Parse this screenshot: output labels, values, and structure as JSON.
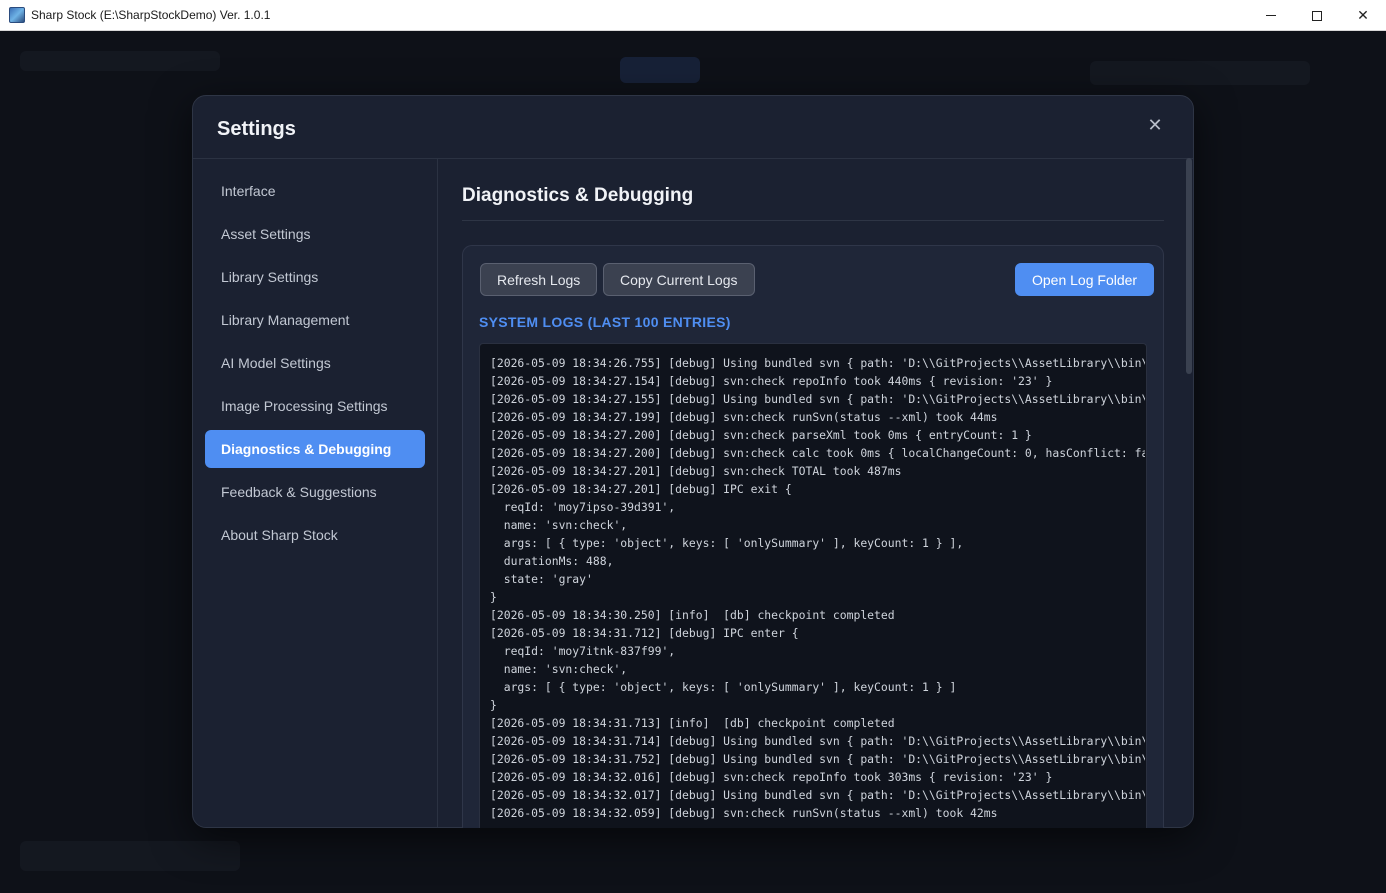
{
  "window": {
    "title": "Sharp Stock (E:\\SharpStockDemo) Ver. 1.0.1",
    "minimize_glyph": "",
    "maximize_glyph": "",
    "close_glyph": "✕"
  },
  "modal": {
    "title": "Settings",
    "close_glyph": "✕"
  },
  "sidebar": {
    "items": [
      {
        "label": "Interface"
      },
      {
        "label": "Asset Settings"
      },
      {
        "label": "Library Settings"
      },
      {
        "label": "Library Management"
      },
      {
        "label": "AI Model Settings"
      },
      {
        "label": "Image Processing Settings"
      },
      {
        "label": "Diagnostics & Debugging",
        "active": true
      },
      {
        "label": "Feedback & Suggestions"
      },
      {
        "label": "About Sharp Stock"
      }
    ]
  },
  "content": {
    "section_title": "Diagnostics & Debugging",
    "buttons": {
      "refresh": "Refresh Logs",
      "copy": "Copy Current Logs",
      "open_folder": "Open Log Folder"
    },
    "logs_label": "SYSTEM LOGS (LAST 100 ENTRIES)",
    "log_lines": [
      "[2026-05-09 18:34:26.755] [debug] Using bundled svn { path: 'D:\\\\GitProjects\\\\AssetLibrary\\\\bin\\\\win",
      "[2026-05-09 18:34:27.154] [debug] svn:check repoInfo took 440ms { revision: '23' }",
      "[2026-05-09 18:34:27.155] [debug] Using bundled svn { path: 'D:\\\\GitProjects\\\\AssetLibrary\\\\bin\\\\win",
      "[2026-05-09 18:34:27.199] [debug] svn:check runSvn(status --xml) took 44ms",
      "[2026-05-09 18:34:27.200] [debug] svn:check parseXml took 0ms { entryCount: 1 }",
      "[2026-05-09 18:34:27.200] [debug] svn:check calc took 0ms { localChangeCount: 0, hasConflict: false",
      "[2026-05-09 18:34:27.201] [debug] svn:check TOTAL took 487ms",
      "[2026-05-09 18:34:27.201] [debug] IPC exit {",
      "  reqId: 'moy7ipso-39d391',",
      "  name: 'svn:check',",
      "  args: [ { type: 'object', keys: [ 'onlySummary' ], keyCount: 1 } ],",
      "  durationMs: 488,",
      "  state: 'gray'",
      "}",
      "[2026-05-09 18:34:30.250] [info]  [db] checkpoint completed",
      "[2026-05-09 18:34:31.712] [debug] IPC enter {",
      "  reqId: 'moy7itnk-837f99',",
      "  name: 'svn:check',",
      "  args: [ { type: 'object', keys: [ 'onlySummary' ], keyCount: 1 } ]",
      "}",
      "[2026-05-09 18:34:31.713] [info]  [db] checkpoint completed",
      "[2026-05-09 18:34:31.714] [debug] Using bundled svn { path: 'D:\\\\GitProjects\\\\AssetLibrary\\\\bin\\\\win",
      "[2026-05-09 18:34:31.752] [debug] Using bundled svn { path: 'D:\\\\GitProjects\\\\AssetLibrary\\\\bin\\\\win",
      "[2026-05-09 18:34:32.016] [debug] svn:check repoInfo took 303ms { revision: '23' }",
      "[2026-05-09 18:34:32.017] [debug] Using bundled svn { path: 'D:\\\\GitProjects\\\\AssetLibrary\\\\bin\\\\win",
      "[2026-05-09 18:34:32.059] [debug] svn:check runSvn(status --xml) took 42ms"
    ]
  },
  "colors": {
    "accent": "#4f8ef2",
    "modal_bg": "#1b2131",
    "log_bg": "#0f131c"
  }
}
